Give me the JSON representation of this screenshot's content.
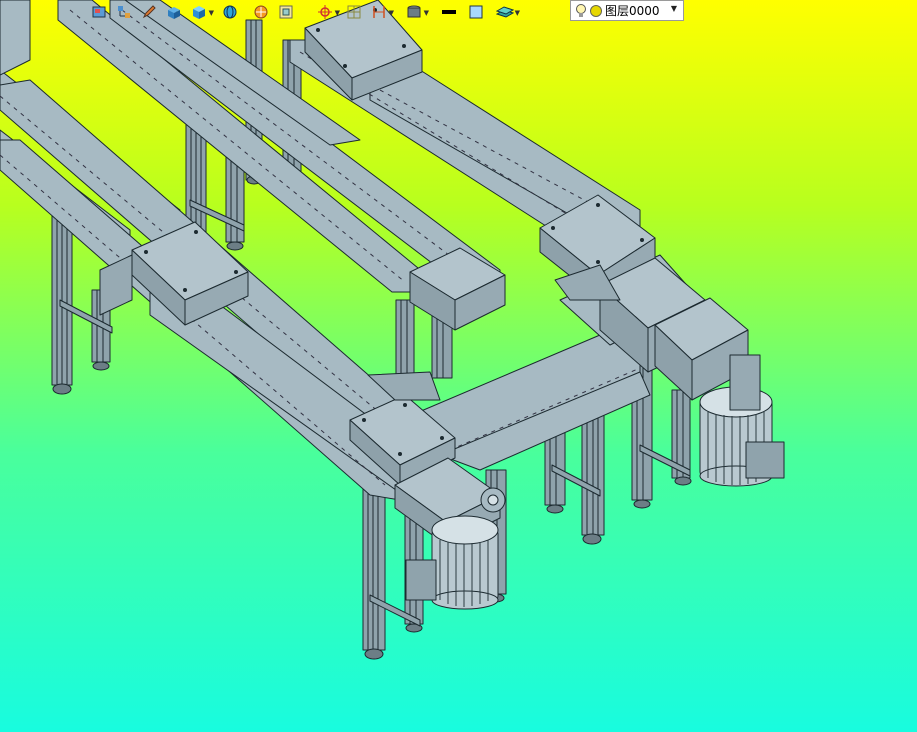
{
  "layer": {
    "name": "图层0000"
  },
  "toolbar": {
    "icons": [
      "display-mode-icon",
      "tree-icon",
      "pencil-icon",
      "solid-box-icon",
      "cube-icon",
      "globe-icon",
      "render-sphere-icon",
      "frame-icon",
      "axis-icon",
      "grid-icon",
      "dimension-icon",
      "material-icon",
      "line-color-icon",
      "fill-color-icon",
      "plane-icon",
      "lightbulb-icon",
      "layer-state-icon"
    ]
  },
  "colors": {
    "background_top": "#ffff00",
    "background_bottom": "#18fcdf",
    "model_metal": "#a7bac3",
    "model_edge": "#1c2a30"
  }
}
